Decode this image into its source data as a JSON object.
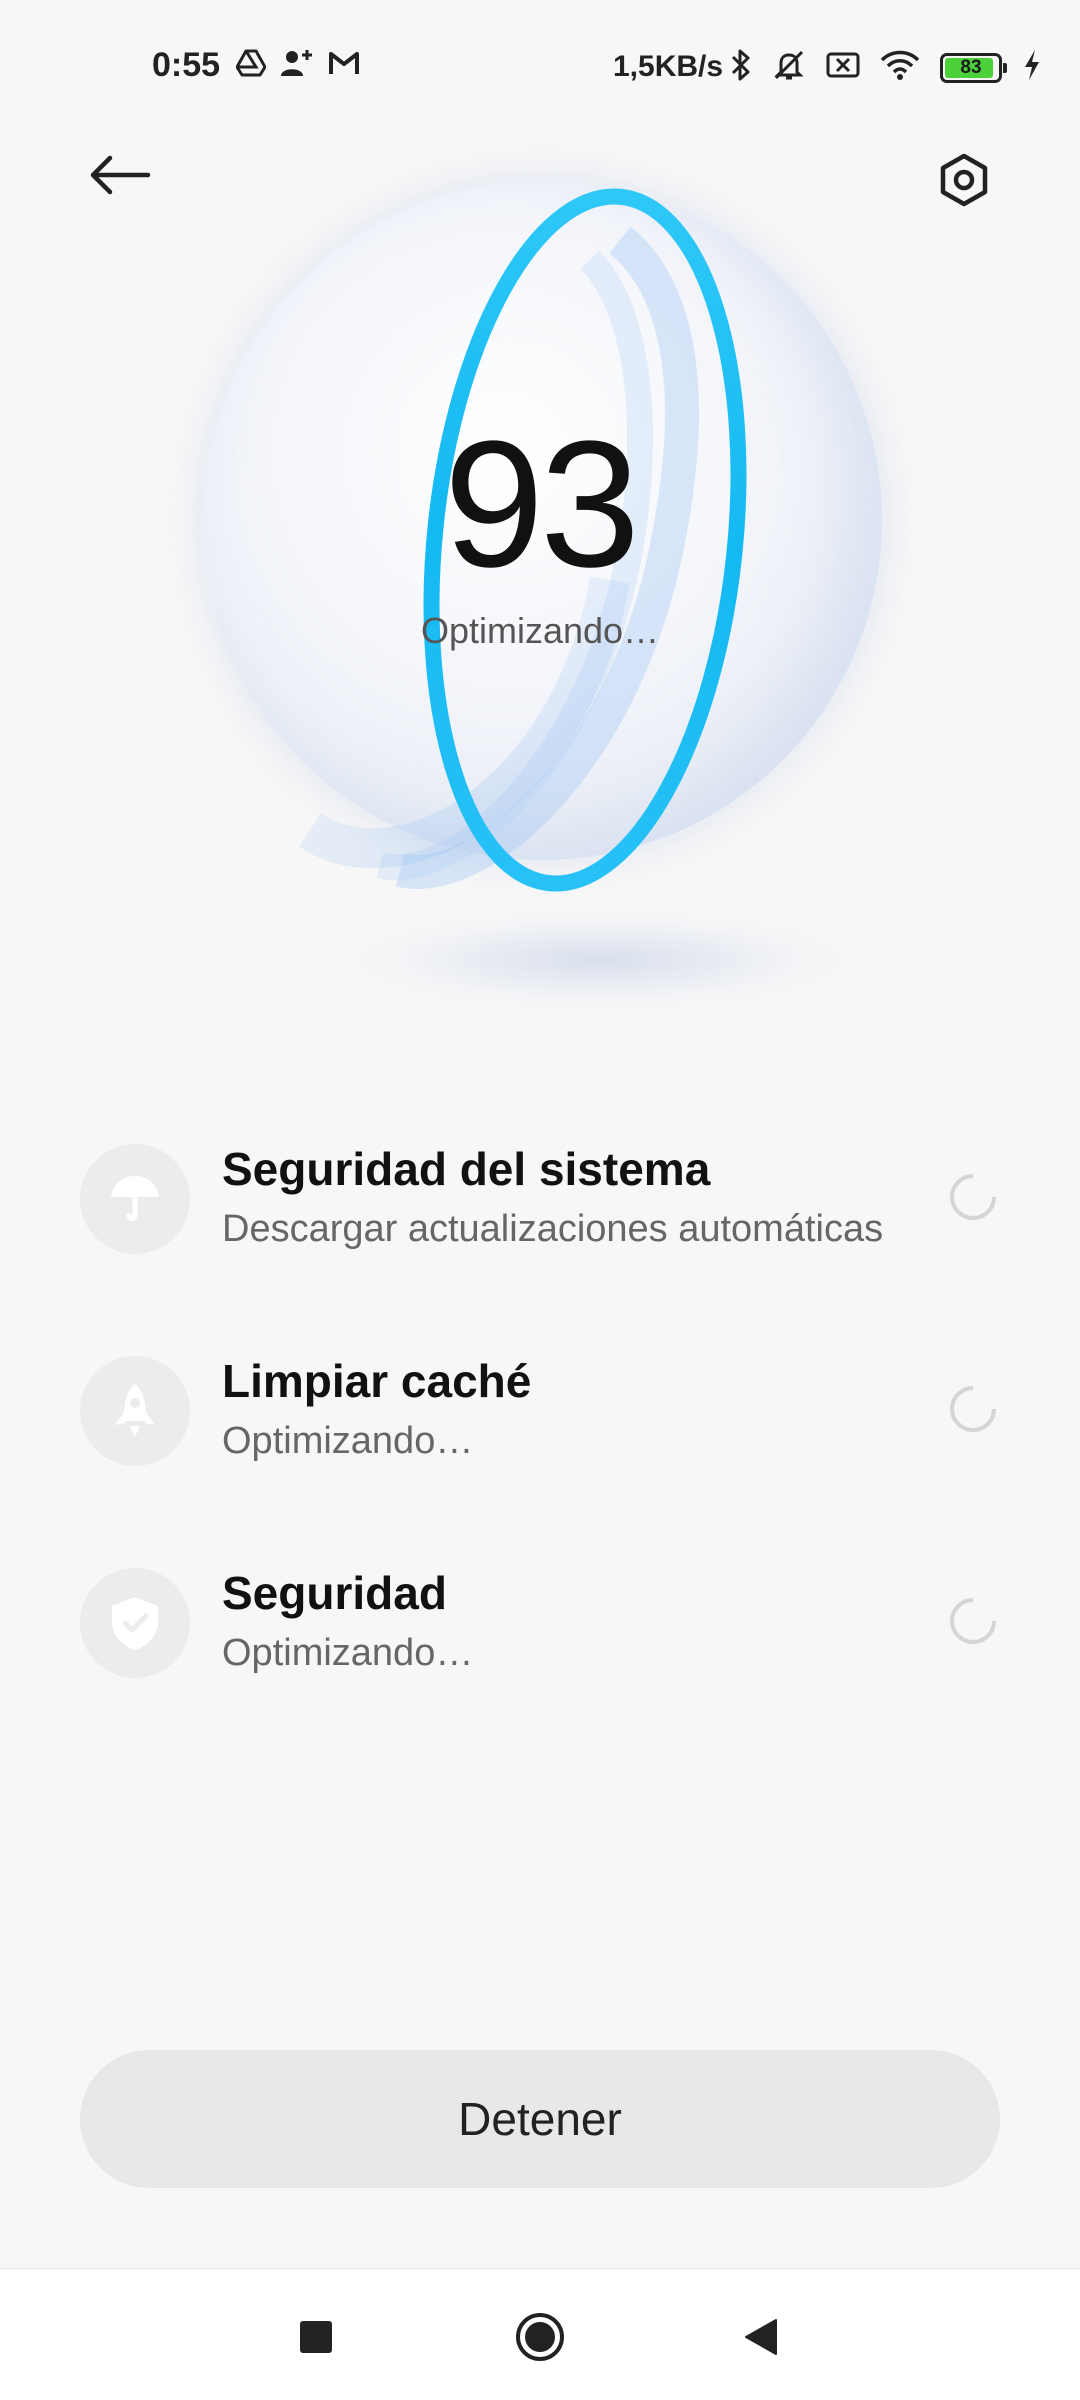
{
  "status_bar": {
    "time": "0:55",
    "network_speed": "1,5KB/s",
    "battery_level": "83",
    "left_icons": [
      "drive-icon",
      "person-add-icon",
      "gmail-icon"
    ],
    "right_icons": [
      "bluetooth-icon",
      "bell-muted-icon",
      "no-sim-icon",
      "wifi-icon",
      "battery-icon",
      "charging-icon"
    ]
  },
  "header": {
    "back_icon": "arrow-left-icon",
    "settings_icon": "hexagon-settings-icon"
  },
  "score": {
    "value": "93",
    "status": "Optimizando…",
    "accent_color": "#1ec3f5"
  },
  "tasks": [
    {
      "title": "Seguridad del sistema",
      "subtitle": "Descargar actualizaciones automáticas",
      "icon": "umbrella-icon"
    },
    {
      "title": "Limpiar caché",
      "subtitle": "Optimizando…",
      "icon": "rocket-icon"
    },
    {
      "title": "Seguridad",
      "subtitle": "Optimizando…",
      "icon": "shield-check-icon"
    }
  ],
  "actions": {
    "stop_label": "Detener"
  },
  "nav_bar": {
    "buttons": [
      "recents-square-icon",
      "home-circle-icon",
      "back-triangle-icon"
    ]
  }
}
